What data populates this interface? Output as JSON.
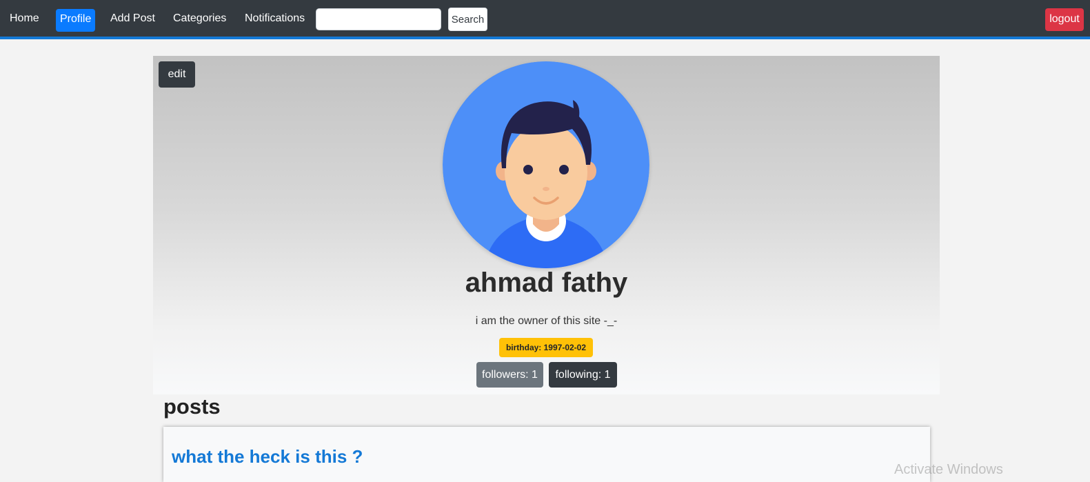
{
  "navbar": {
    "links": [
      "Home",
      "Profile",
      "Add Post",
      "Categories",
      "Notifications"
    ],
    "active": "Profile",
    "search_placeholder": "",
    "search_button": "Search",
    "logout_button": "logout"
  },
  "profile": {
    "edit_button": "edit",
    "name": "ahmad fathy",
    "bio": "i am the owner of this site -_-",
    "birthday": "birthday: 1997-02-02",
    "followers": "followers: 1",
    "following": "following: 1"
  },
  "posts": {
    "heading": "posts",
    "items": [
      {
        "title": "what the heck is this ?"
      }
    ]
  },
  "watermark": "Activate Windows",
  "colors": {
    "navbar_bg": "#343a40",
    "navbar_border": "#1479d6",
    "active_link": "#0a7bff",
    "logout": "#dc3545",
    "badge": "#ffc107",
    "link_blue": "#1479d6",
    "avatar_bg": "#4d8ff8"
  }
}
